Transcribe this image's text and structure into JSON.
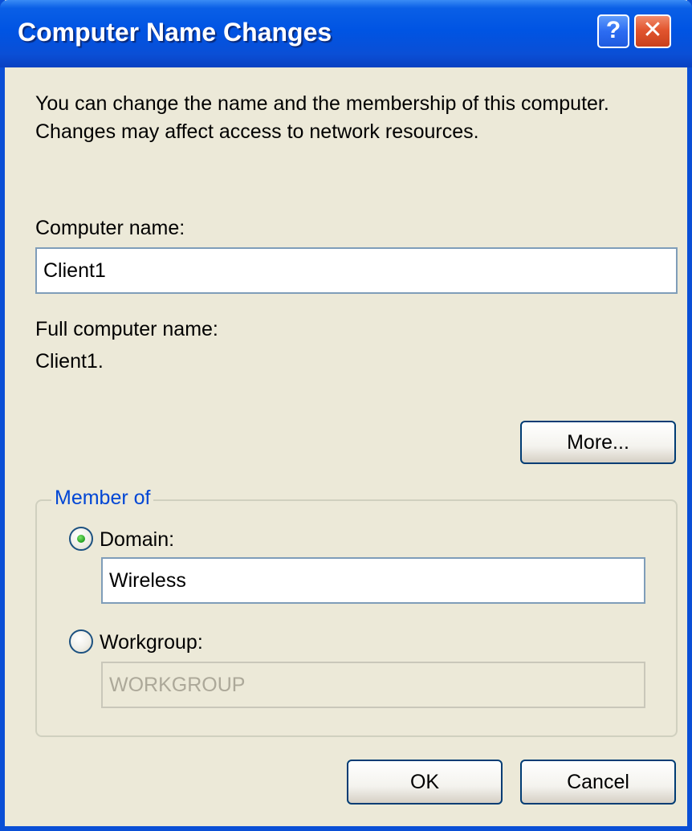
{
  "window": {
    "title": "Computer Name Changes",
    "help_glyph": "?",
    "close_glyph": "✕"
  },
  "description": "You can change the name and the membership of this computer. Changes may affect access to network resources.",
  "computer_name": {
    "label": "Computer name:",
    "value": "Client1"
  },
  "full_name": {
    "label": "Full computer name:",
    "value": "Client1."
  },
  "more_button": "More...",
  "member_of": {
    "label": "Member of",
    "domain": {
      "label": "Domain:",
      "selected": true,
      "value": "Wireless"
    },
    "workgroup": {
      "label": "Workgroup:",
      "selected": false,
      "value": "WORKGROUP",
      "disabled": true
    }
  },
  "buttons": {
    "ok": "OK",
    "cancel": "Cancel"
  }
}
